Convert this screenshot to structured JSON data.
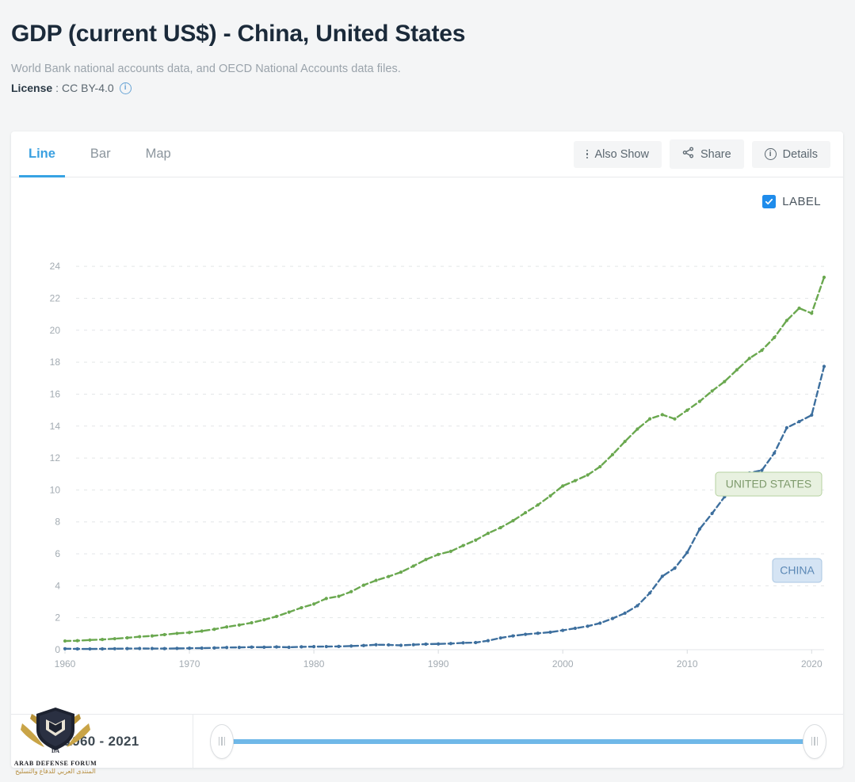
{
  "header": {
    "title": "GDP (current US$) - China, United States",
    "source": "World Bank national accounts data, and OECD National Accounts data files.",
    "license_key": "License",
    "license_sep": ":",
    "license_value": "CC BY-4.0",
    "license_info_icon": "info-circle-icon"
  },
  "tabs": [
    {
      "label": "Line",
      "active": true
    },
    {
      "label": "Bar",
      "active": false
    },
    {
      "label": "Map",
      "active": false
    }
  ],
  "toolbar": {
    "also_show": "Also Show",
    "also_show_icon": "vertical-dots-icon",
    "share": "Share",
    "share_icon": "share-icon",
    "details": "Details",
    "details_icon": "info-circle-icon"
  },
  "label_toggle": {
    "text": "LABEL",
    "checked": true,
    "icon": "checkmark-icon",
    "color": "#1f8ceb"
  },
  "footer": {
    "range_text": "1960 - 2021",
    "slider_color": "#6fb8e8",
    "handle_left_icon": "grip-handle-icon",
    "handle_right_icon": "grip-handle-icon"
  },
  "watermark": {
    "name": "ARAB DEFENSE FORUM",
    "arabic": "المنتدى العربي للدفاع والتسليح",
    "monogram": "DA"
  },
  "chart_data": {
    "type": "line",
    "title": "GDP (current US$) - China, United States",
    "xlabel": "",
    "ylabel": "",
    "ylim": [
      0,
      25
    ],
    "xlim": [
      1960,
      2021
    ],
    "yticks": [
      0,
      2,
      4,
      6,
      8,
      10,
      12,
      14,
      16,
      18,
      20,
      22,
      24
    ],
    "xticks": [
      1960,
      1970,
      1980,
      1990,
      2000,
      2010,
      2020
    ],
    "grid": true,
    "units": "trillions current US$",
    "legend_position": "inline-labels",
    "annotations": [
      {
        "text": "UNITED STATES",
        "series": "United States",
        "year": 2019
      },
      {
        "text": "CHINA",
        "series": "China",
        "year": 2020
      }
    ],
    "x": [
      1960,
      1961,
      1962,
      1963,
      1964,
      1965,
      1966,
      1967,
      1968,
      1969,
      1970,
      1971,
      1972,
      1973,
      1974,
      1975,
      1976,
      1977,
      1978,
      1979,
      1980,
      1981,
      1982,
      1983,
      1984,
      1985,
      1986,
      1987,
      1988,
      1989,
      1990,
      1991,
      1992,
      1993,
      1994,
      1995,
      1996,
      1997,
      1998,
      1999,
      2000,
      2001,
      2002,
      2003,
      2004,
      2005,
      2006,
      2007,
      2008,
      2009,
      2010,
      2011,
      2012,
      2013,
      2014,
      2015,
      2016,
      2017,
      2018,
      2019,
      2020,
      2021
    ],
    "series": [
      {
        "name": "United States",
        "color": "#6aa84f",
        "values": [
          0.543,
          0.563,
          0.605,
          0.639,
          0.686,
          0.744,
          0.815,
          0.862,
          0.943,
          1.02,
          1.073,
          1.165,
          1.279,
          1.426,
          1.545,
          1.685,
          1.873,
          2.082,
          2.352,
          2.627,
          2.857,
          3.207,
          3.344,
          3.634,
          4.038,
          4.339,
          4.58,
          4.855,
          5.236,
          5.642,
          5.963,
          6.158,
          6.52,
          6.859,
          7.287,
          7.64,
          8.073,
          8.578,
          9.063,
          9.631,
          10.251,
          10.582,
          10.936,
          11.458,
          12.214,
          13.037,
          13.815,
          14.452,
          14.713,
          14.449,
          14.992,
          15.543,
          16.197,
          16.785,
          17.527,
          18.238,
          18.745,
          19.543,
          20.612,
          21.381,
          21.06,
          23.315
        ]
      },
      {
        "name": "China",
        "color": "#3d6f9e",
        "values": [
          0.06,
          0.05,
          0.047,
          0.051,
          0.06,
          0.07,
          0.076,
          0.073,
          0.07,
          0.079,
          0.092,
          0.099,
          0.113,
          0.138,
          0.144,
          0.163,
          0.154,
          0.174,
          0.15,
          0.178,
          0.191,
          0.196,
          0.205,
          0.23,
          0.26,
          0.31,
          0.3,
          0.273,
          0.312,
          0.348,
          0.361,
          0.383,
          0.427,
          0.445,
          0.564,
          0.735,
          0.864,
          0.962,
          1.029,
          1.094,
          1.211,
          1.339,
          1.471,
          1.66,
          1.955,
          2.286,
          2.752,
          3.55,
          4.594,
          5.102,
          6.087,
          7.552,
          8.532,
          9.57,
          10.476,
          11.062,
          11.233,
          12.31,
          13.895,
          14.28,
          14.688,
          17.734
        ]
      }
    ]
  }
}
